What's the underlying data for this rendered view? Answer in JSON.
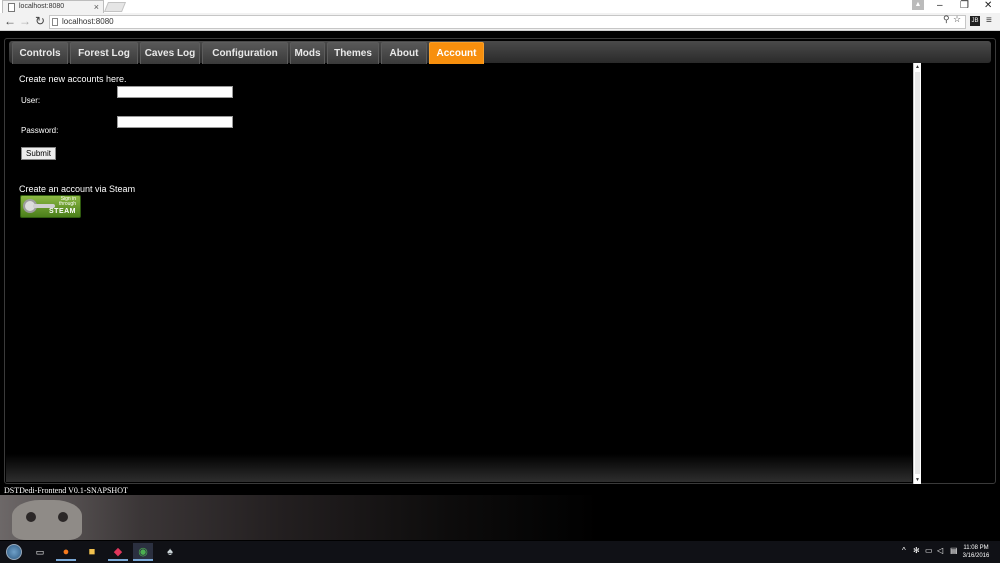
{
  "browser": {
    "tab_title": "localhost:8080",
    "tab_close": "×",
    "url": "localhost:8080",
    "window_controls": {
      "minimize": "–",
      "restore": "❐",
      "close": "✕"
    }
  },
  "app": {
    "nav_tabs": [
      {
        "label": "Controls"
      },
      {
        "label": "Forest Log"
      },
      {
        "label": "Caves Log"
      },
      {
        "label": "Configuration"
      },
      {
        "label": "Mods"
      },
      {
        "label": "Themes"
      },
      {
        "label": "About"
      },
      {
        "label": "Account"
      }
    ],
    "active_tab": "Account",
    "accent_color": "#f78f0d",
    "account": {
      "intro": "Create new accounts here.",
      "user_label": "User:",
      "user_value": "",
      "password_label": "Password:",
      "password_value": "",
      "submit_label": "Submit",
      "steam_intro": "Create an account via Steam",
      "steam_button": {
        "line1": "Sign in",
        "line2": "through",
        "brand": "STEAM"
      }
    },
    "version": "DSTDedi-Frontend V0.1-SNAPSHOT"
  },
  "taskbar": {
    "clock_time": "11:08 PM",
    "clock_date": "3/16/2016"
  }
}
